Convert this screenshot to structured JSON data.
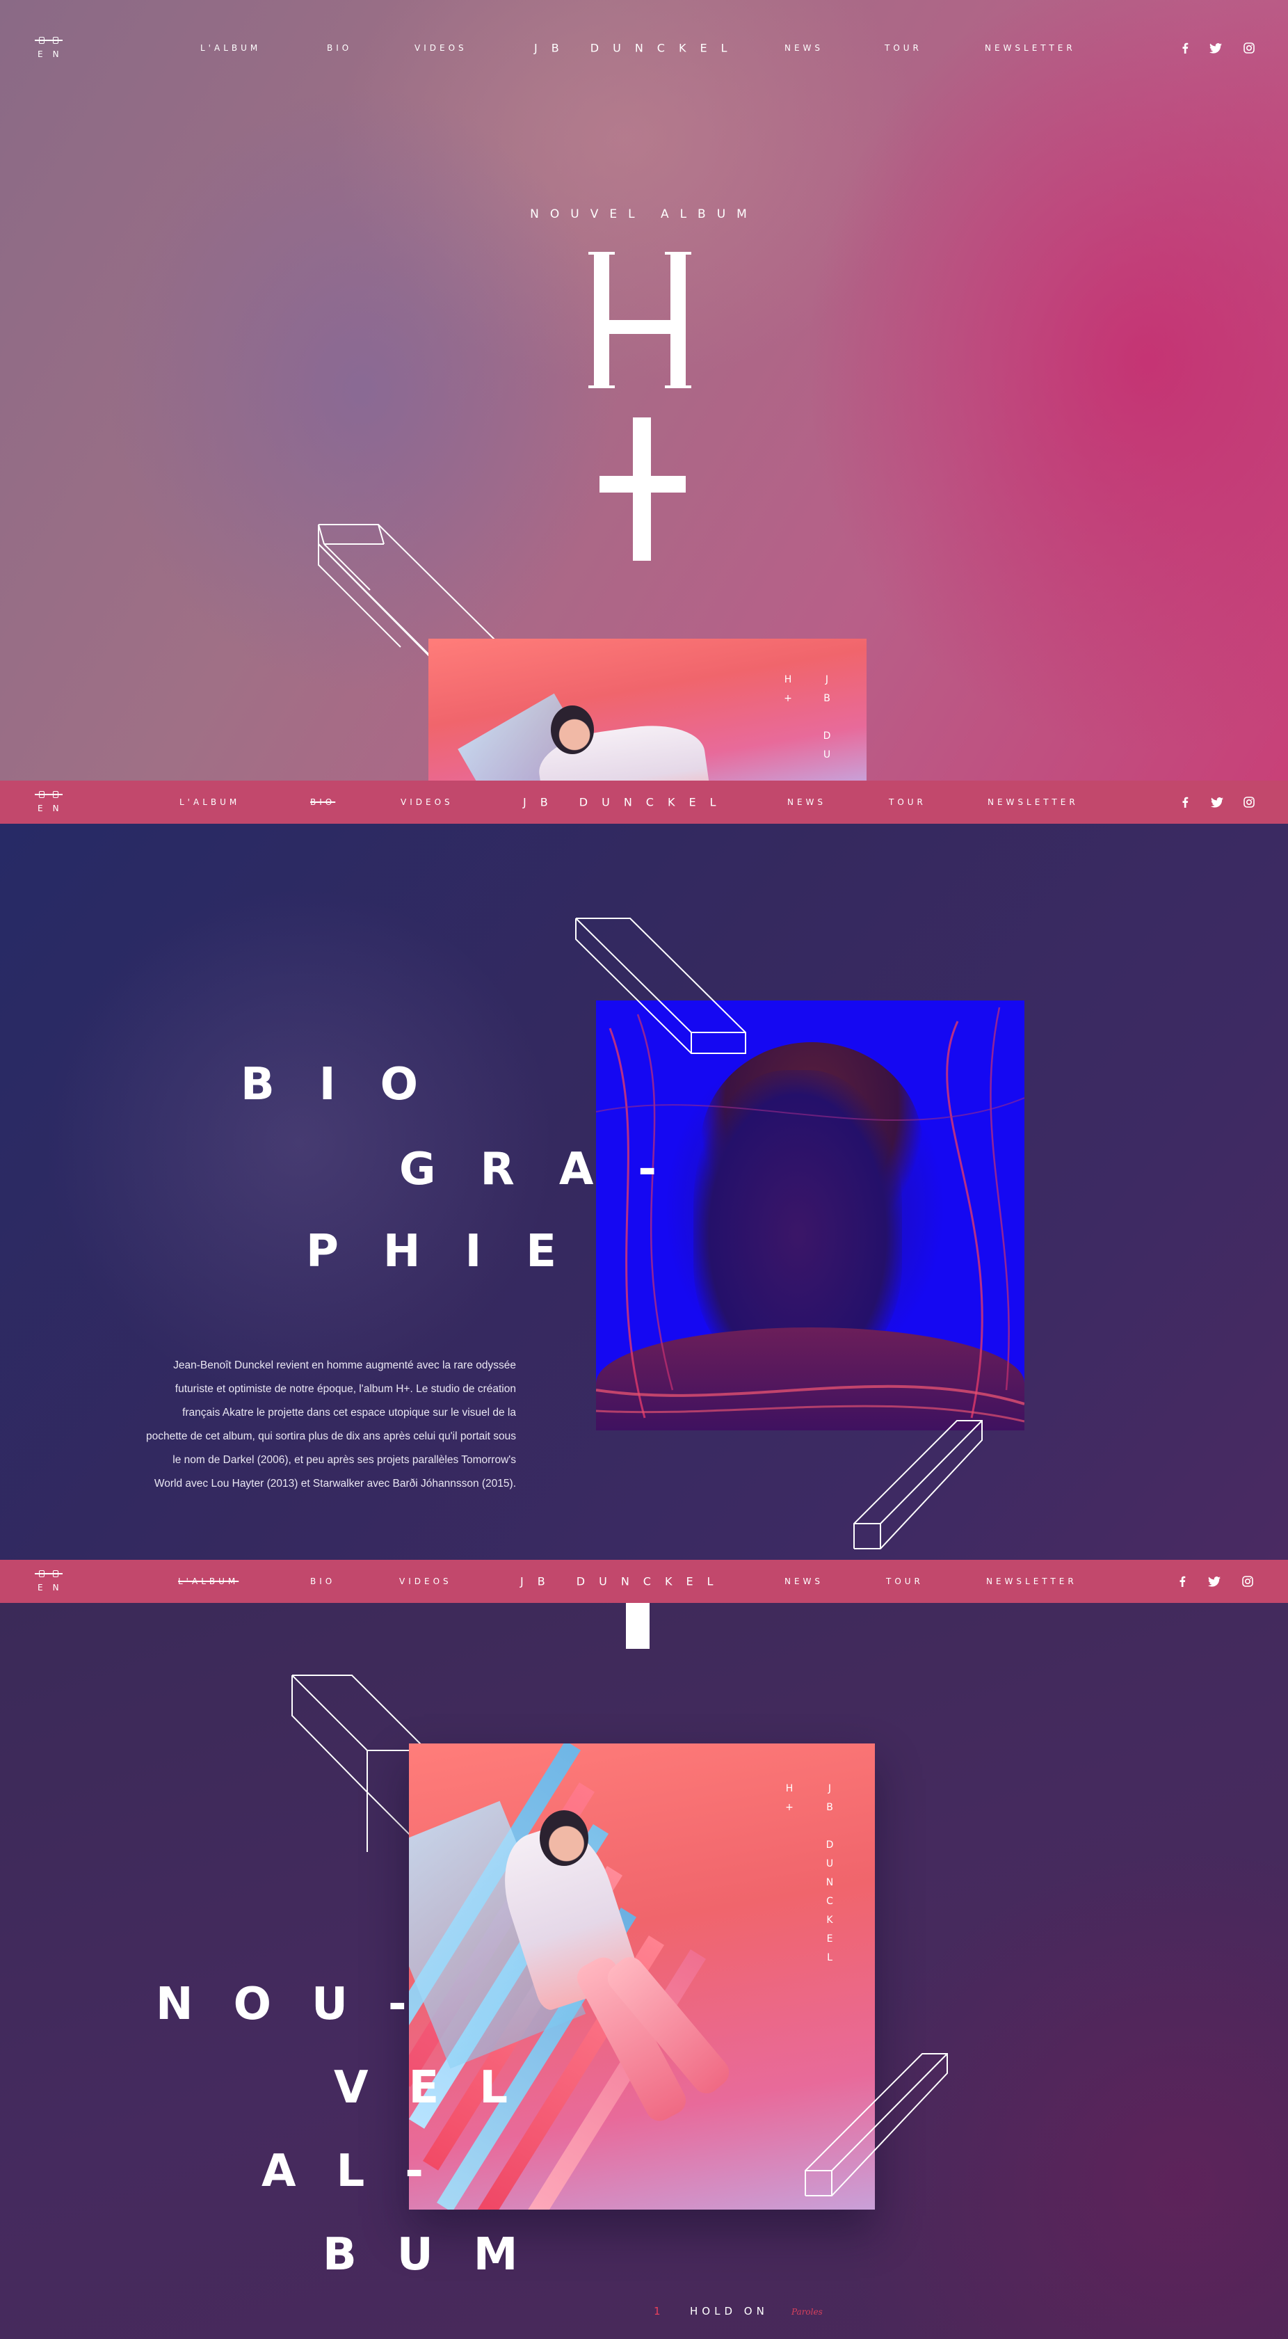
{
  "nav": {
    "lang": "EN",
    "links_left": [
      "L'ALBUM",
      "BIO",
      "VIDEOS"
    ],
    "brand": "JB DUNCKEL",
    "links_right": [
      "NEWS",
      "TOUR",
      "NEWSLETTER"
    ],
    "social": [
      "f",
      "t",
      "o"
    ]
  },
  "hero": {
    "kicker": "NOUVEL ALBUM",
    "cover_text_left": [
      "H",
      "+"
    ],
    "cover_text_right": [
      "J",
      "B",
      "",
      "D",
      "U"
    ]
  },
  "bio": {
    "title_lines": [
      "BIO",
      "GRA-",
      "PHIE"
    ],
    "text": "Jean-Benoît Dunckel revient en homme augmenté avec la rare odyssée futuriste et optimiste de notre époque, l'album H+. Le studio de création français Akatre le projette dans cet espace utopique sur le visuel de la pochette de cet album, qui sortira plus de dix ans après celui qu'il portait sous le nom de Darkel (2006), et peu après ses projets parallèles Tomorrow's World avec Lou Hayter (2013) et Starwalker avec Barði Jóhannsson (2015)."
  },
  "album": {
    "title_lines": [
      "NOU-",
      "VEL",
      "AL-",
      "BUM"
    ],
    "cover_text_left": [
      "H",
      "+"
    ],
    "cover_text_right": [
      "J",
      "B",
      "",
      "D",
      "U",
      "N",
      "C",
      "K",
      "E",
      "L"
    ],
    "track_number": "1",
    "track_title": "HOLD ON",
    "track_subtitle": "Paroles"
  },
  "colors": {
    "nav_bar": "#c2486c",
    "accent": "#e8405c",
    "bio_portrait_blue": "#1508f2"
  },
  "icons": [
    "facebook-icon",
    "twitter-icon",
    "instagram-icon",
    "jbd-logo-icon"
  ]
}
